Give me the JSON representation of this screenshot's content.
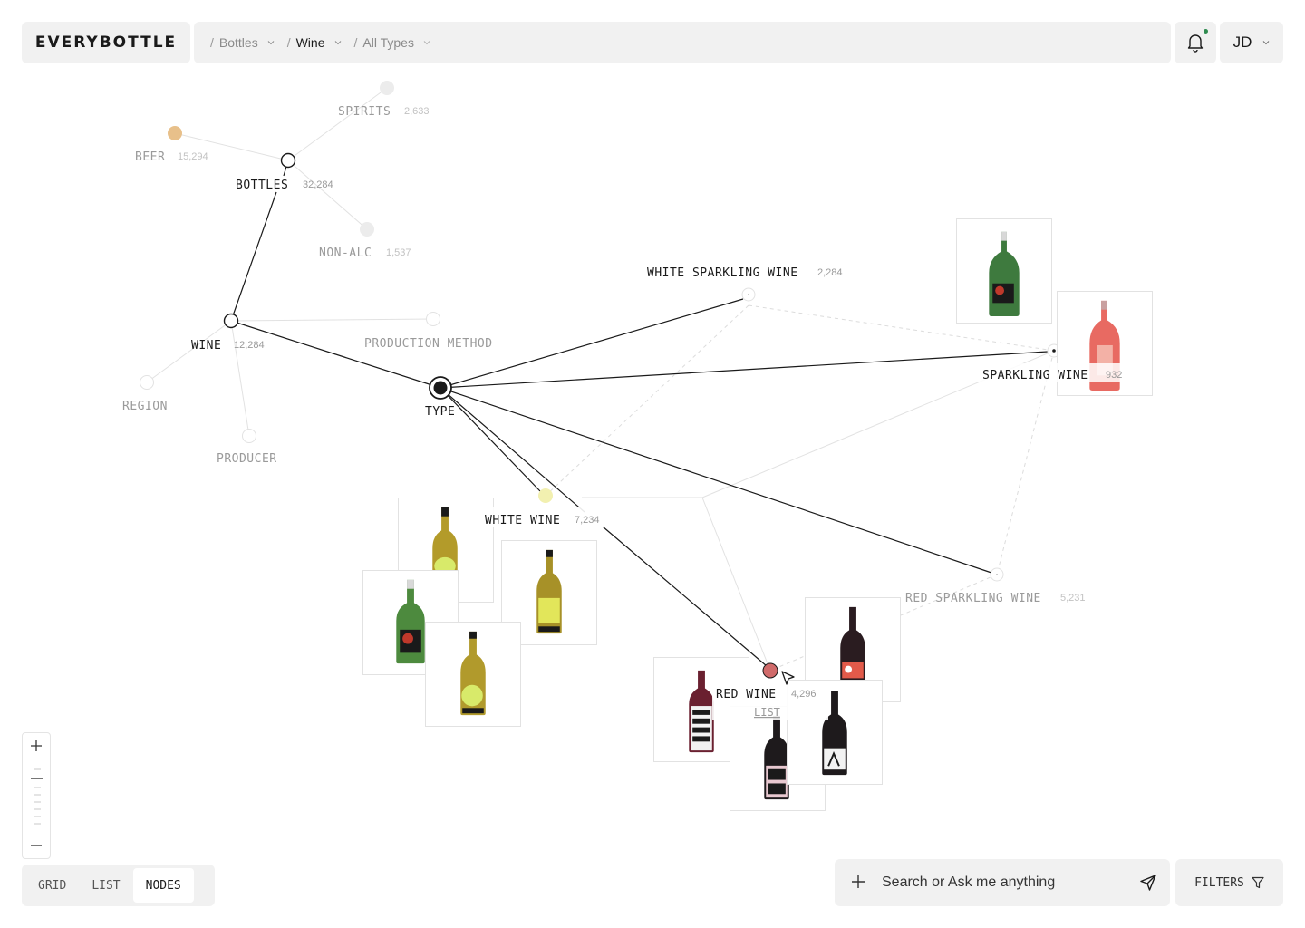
{
  "brand": {
    "name": "EVERYBOTTLE"
  },
  "breadcrumb": [
    {
      "label": "Bottles",
      "state": "muted"
    },
    {
      "label": "Wine",
      "state": "active"
    },
    {
      "label": "All Types",
      "state": "muted"
    }
  ],
  "notifications": {
    "has_unread": true,
    "accent": "#2e8b4f"
  },
  "user": {
    "initials": "JD"
  },
  "graph": {
    "nodes": {
      "spirits": {
        "label": "SPIRITS",
        "count": "2,633"
      },
      "beer": {
        "label": "BEER",
        "count": "15,294"
      },
      "bottles": {
        "label": "BOTTLES",
        "count": "32,284"
      },
      "non_alc": {
        "label": "NON-ALC",
        "count": "1,537"
      },
      "wine": {
        "label": "WINE",
        "count": "12,284"
      },
      "production_method": {
        "label": "PRODUCTION METHOD"
      },
      "region": {
        "label": "REGION"
      },
      "producer": {
        "label": "PRODUCER"
      },
      "type": {
        "label": "TYPE"
      },
      "white_sparkling_wine": {
        "label": "WHITE SPARKLING WINE",
        "count": "2,284"
      },
      "sparkling_wine": {
        "label": "SPARKLING WINE",
        "count": "932"
      },
      "white_wine": {
        "label": "WHITE WINE",
        "count": "7,234"
      },
      "red_sparkling_wine": {
        "label": "RED SPARKLING WINE",
        "count": "5,231"
      },
      "red_wine": {
        "label": "RED WINE",
        "count": "4,296",
        "link": "LIST"
      }
    },
    "colors": {
      "beer": "#e8c08a",
      "white_wine": "#f2f0b0",
      "red_wine": "#d06a6a"
    }
  },
  "zoom": {
    "in_icon": "plus-icon",
    "out_icon": "minus-icon"
  },
  "views": {
    "tabs": [
      "GRID",
      "LIST",
      "NODES"
    ],
    "selected": "NODES"
  },
  "search": {
    "placeholder": "Search or Ask me anything",
    "add_icon": "plus-icon",
    "send_icon": "send-icon"
  },
  "filters": {
    "label": "FILTERS",
    "icon": "filter-icon"
  }
}
